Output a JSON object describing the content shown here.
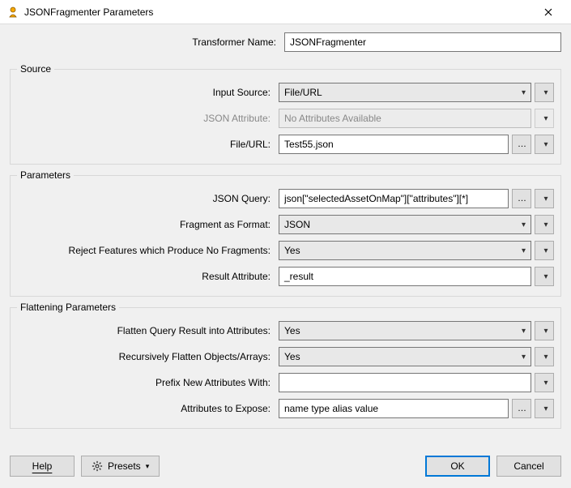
{
  "titlebar": {
    "title": "JSONFragmenter Parameters"
  },
  "transformerName": {
    "label": "Transformer Name:",
    "value": "JSONFragmenter"
  },
  "groups": {
    "source": "Source",
    "parameters": "Parameters",
    "flattening": "Flattening Parameters"
  },
  "source": {
    "inputSource": {
      "label": "Input Source:",
      "value": "File/URL"
    },
    "jsonAttribute": {
      "label": "JSON Attribute:",
      "value": "No Attributes Available"
    },
    "fileUrl": {
      "label": "File/URL:",
      "value": "Test55.json"
    }
  },
  "params": {
    "jsonQuery": {
      "label": "JSON Query:",
      "value": "json[\"selectedAssetOnMap\"][\"attributes\"][*]"
    },
    "fragmentFormat": {
      "label": "Fragment as Format:",
      "value": "JSON"
    },
    "reject": {
      "label": "Reject Features which Produce No Fragments:",
      "value": "Yes"
    },
    "resultAttr": {
      "label": "Result Attribute:",
      "value": "_result"
    }
  },
  "flatten": {
    "flattenResult": {
      "label": "Flatten Query Result into Attributes:",
      "value": "Yes"
    },
    "recursive": {
      "label": "Recursively Flatten Objects/Arrays:",
      "value": "Yes"
    },
    "prefix": {
      "label": "Prefix New Attributes With:",
      "value": ""
    },
    "expose": {
      "label": "Attributes to Expose:",
      "value": "name type alias value"
    }
  },
  "footer": {
    "help": "Help",
    "presets": "Presets",
    "ok": "OK",
    "cancel": "Cancel"
  }
}
